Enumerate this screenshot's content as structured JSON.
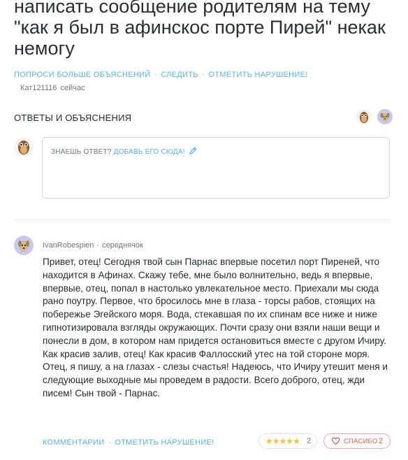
{
  "question": {
    "title": "написать сообщение родителям на тему \"как я был в афинскос порте Пирей\" некак немогу",
    "links": [
      "ПОПРОСИ БОЛЬШЕ ОБЪЯСНЕНИЙ",
      "СЛЕДИТЬ",
      "ОТМЕТИТЬ НАРУШЕНИЕ!"
    ],
    "author": "Кат121116",
    "time": "сейчас"
  },
  "answers_section": {
    "title": "ОТВЕТЫ И ОБЪЯСНЕНИЯ",
    "prompt": "ЗНАЕШЬ ОТВЕТ?",
    "add_link": "ДОБАВЬ ЕГО СЮДА!"
  },
  "answer": {
    "author": "IvanRobespien",
    "rank": "середнячок",
    "text": "Привет, отец! Сегодня твой сын Парнас впервые посетил порт Пиреней, что находится в Афинах. Скажу тебе, мне было волнительно, ведь я впервые, впервые, отец, попал в настолько увлекательное место. Приехали мы сюда рано поутру. Первое, что бросилось мне в глаза - торсы рабов, стоящих на побережье Эгейского моря. Вода, стекавшая по их спинам все ниже и ниже гипнотизировала взгляды окружающих. Почти сразу они взяли наши вещи и понесли в дом, в котором нам придется остановиться вместе с другом Ичиру. Как красив залив, отец! Как красив Фаллосский утес на той стороне моря. Отец, я пишу, а на глазах - слезы счастья! Надеюсь, что Ичиру утешит меня и следующие выходные мы проведем в радости. Всего доброго, отец, жди писем! Сын твой - Парнас.",
    "comments_label": "КОММЕНТАРИИ",
    "report_label": "ОТМЕТИТЬ НАРУШЕНИЕ!",
    "rating_stars": 5,
    "rating_count": "2",
    "thanks_label": "СПАСИБО",
    "thanks_count": "2"
  },
  "colors": {
    "link": "#4fb3f6",
    "star": "#fbbe2e",
    "thanks": "#e2564f"
  }
}
